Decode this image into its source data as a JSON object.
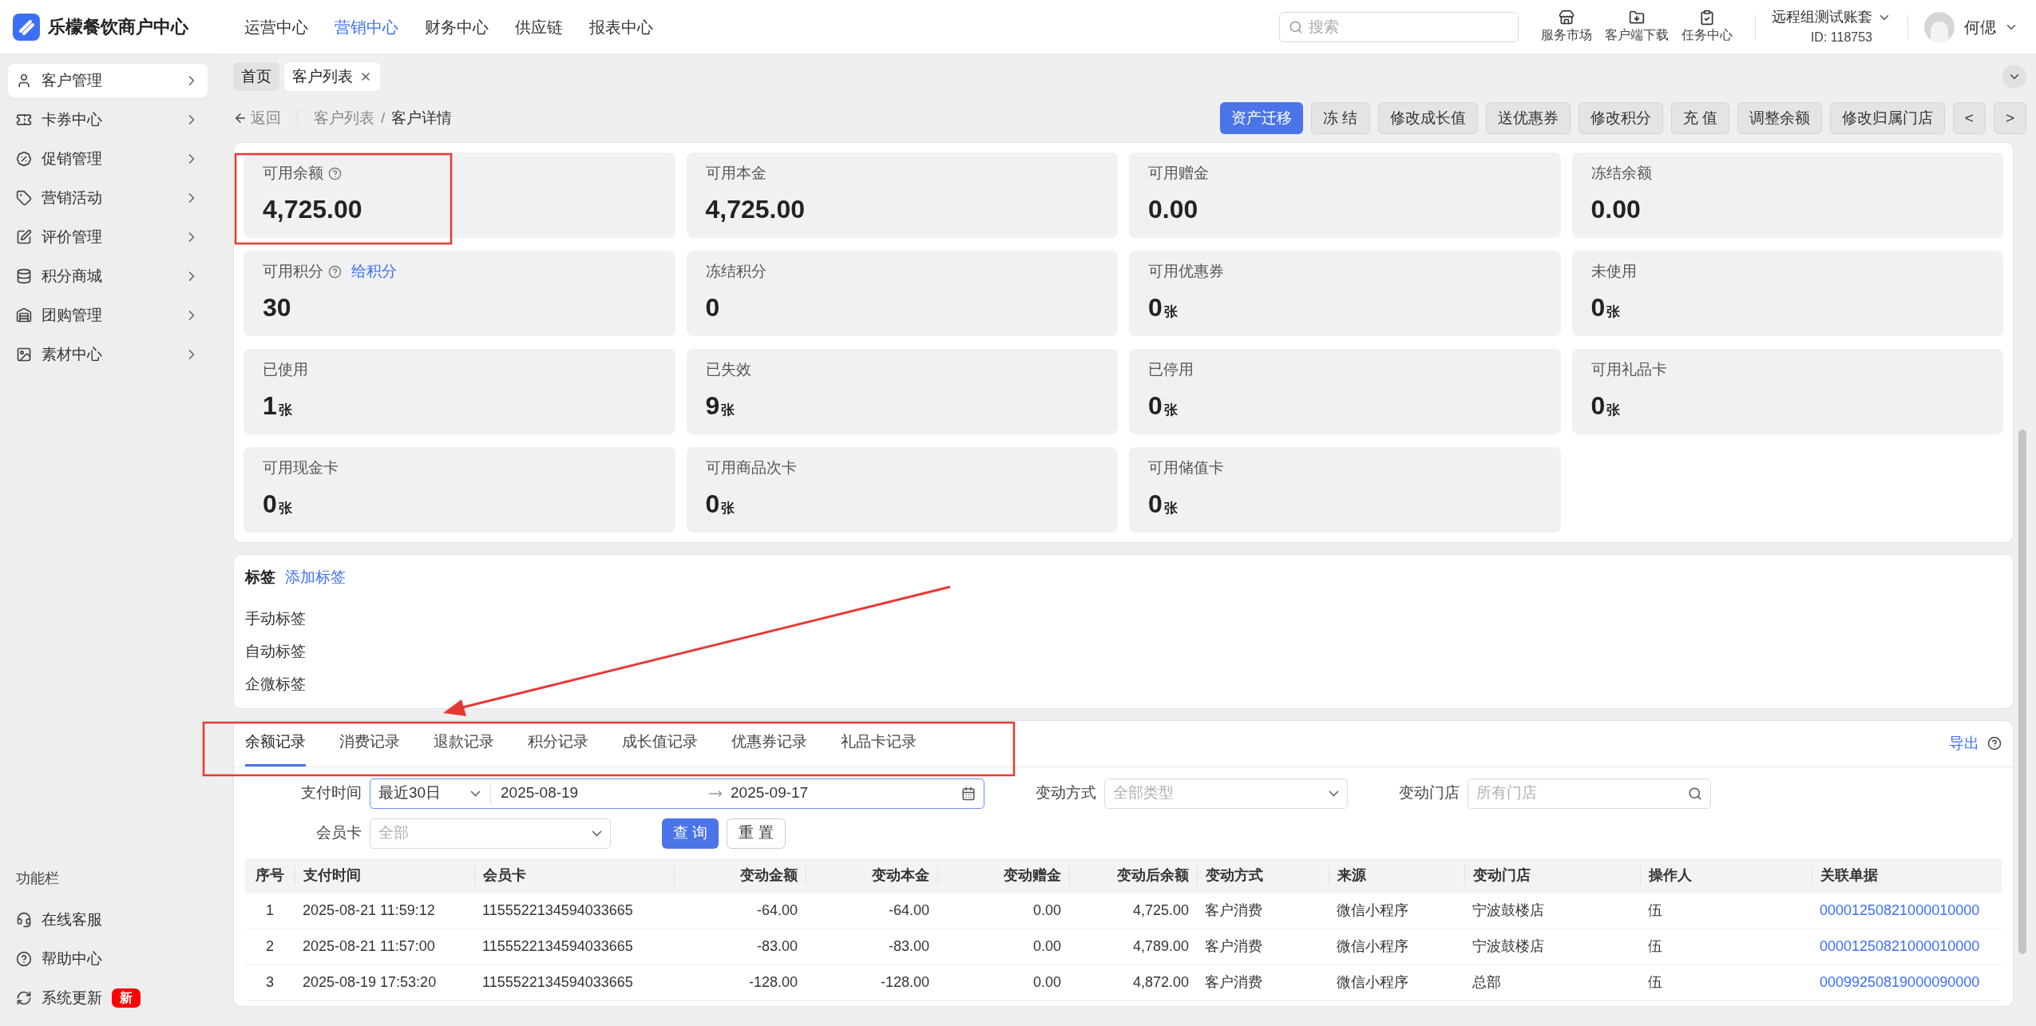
{
  "app": {
    "name": "乐檬餐饮商户中心"
  },
  "top_nav": [
    {
      "label": "运营中心",
      "selected": false
    },
    {
      "label": "营销中心",
      "selected": true
    },
    {
      "label": "财务中心",
      "selected": false
    },
    {
      "label": "供应链",
      "selected": false
    },
    {
      "label": "报表中心",
      "selected": false
    }
  ],
  "search": {
    "placeholder": "搜索"
  },
  "header_tools": [
    {
      "label": "服务市场",
      "kind": "market"
    },
    {
      "label": "客户端下载",
      "kind": "download"
    },
    {
      "label": "任务中心",
      "kind": "tasks"
    }
  ],
  "account": {
    "name": "远程组测试账套",
    "id": "ID: 118753"
  },
  "user": {
    "name": "何偲"
  },
  "sidebar": {
    "items": [
      {
        "label": "客户管理",
        "kind": "user",
        "selected": true
      },
      {
        "label": "卡券中心",
        "kind": "ticket",
        "selected": false
      },
      {
        "label": "促销管理",
        "kind": "promo",
        "selected": false
      },
      {
        "label": "营销活动",
        "kind": "tag",
        "selected": false
      },
      {
        "label": "评价管理",
        "kind": "review",
        "selected": false
      },
      {
        "label": "积分商城",
        "kind": "points",
        "selected": false
      },
      {
        "label": "团购管理",
        "kind": "store",
        "selected": false
      },
      {
        "label": "素材中心",
        "kind": "image",
        "selected": false
      }
    ],
    "section_title": "功能栏",
    "footer_items": [
      {
        "label": "在线客服",
        "kind": "support"
      },
      {
        "label": "帮助中心",
        "kind": "help"
      },
      {
        "label": "系统更新",
        "kind": "update",
        "badge": "新"
      }
    ]
  },
  "page_tabs": [
    {
      "label": "首页",
      "selected": false,
      "closable": false
    },
    {
      "label": "客户列表",
      "selected": true,
      "closable": true
    }
  ],
  "breadcrumb": {
    "back": "返回",
    "items": [
      "客户列表",
      "客户详情"
    ],
    "separator": "/"
  },
  "actions": [
    {
      "label": "资产迁移",
      "primary": true
    },
    {
      "label": "冻 结",
      "primary": false
    },
    {
      "label": "修改成长值",
      "primary": false
    },
    {
      "label": "送优惠券",
      "primary": false
    },
    {
      "label": "修改积分",
      "primary": false
    },
    {
      "label": "充 值",
      "primary": false
    },
    {
      "label": "调整余额",
      "primary": false
    },
    {
      "label": "修改归属门店",
      "primary": false
    },
    {
      "label": "<",
      "primary": false
    },
    {
      "label": ">",
      "primary": false
    }
  ],
  "stats": [
    {
      "label": "可用余额",
      "value": "4,725.00",
      "help": true
    },
    {
      "label": "可用本金",
      "value": "4,725.00"
    },
    {
      "label": "可用赠金",
      "value": "0.00"
    },
    {
      "label": "冻结余额",
      "value": "0.00"
    },
    {
      "label": "可用积分",
      "value": "30",
      "help": true,
      "link": "给积分"
    },
    {
      "label": "冻结积分",
      "value": "0"
    },
    {
      "label": "可用优惠券",
      "value": "0",
      "unit": "张"
    },
    {
      "label": "未使用",
      "value": "0",
      "unit": "张"
    },
    {
      "label": "已使用",
      "value": "1",
      "unit": "张"
    },
    {
      "label": "已失效",
      "value": "9",
      "unit": "张"
    },
    {
      "label": "已停用",
      "value": "0",
      "unit": "张"
    },
    {
      "label": "可用礼品卡",
      "value": "0",
      "unit": "张"
    },
    {
      "label": "可用现金卡",
      "value": "0",
      "unit": "张"
    },
    {
      "label": "可用商品次卡",
      "value": "0",
      "unit": "张"
    },
    {
      "label": "可用储值卡",
      "value": "0",
      "unit": "张"
    }
  ],
  "tags": {
    "title": "标签",
    "add_link": "添加标签",
    "groups": [
      "手动标签",
      "自动标签",
      "企微标签"
    ]
  },
  "records": {
    "tabs": [
      {
        "label": "余额记录",
        "selected": true
      },
      {
        "label": "消费记录",
        "selected": false
      },
      {
        "label": "退款记录",
        "selected": false
      },
      {
        "label": "积分记录",
        "selected": false
      },
      {
        "label": "成长值记录",
        "selected": false
      },
      {
        "label": "优惠券记录",
        "selected": false
      },
      {
        "label": "礼品卡记录",
        "selected": false
      }
    ],
    "export": "导出",
    "filters": [
      {
        "label": "支付时间",
        "kind": "daterange",
        "preset": "最近30日",
        "start": "2025-08-19",
        "end": "2025-09-17",
        "focused": true
      },
      {
        "label": "变动方式",
        "kind": "select",
        "placeholder": "全部类型"
      },
      {
        "label": "变动门店",
        "kind": "search",
        "placeholder": "所有门店"
      },
      {
        "label": "会员卡",
        "kind": "select",
        "placeholder": "全部"
      }
    ],
    "buttons": [
      {
        "label": "查 询",
        "primary": true
      },
      {
        "label": "重 置",
        "primary": false
      }
    ],
    "table": {
      "columns": [
        "序号",
        "支付时间",
        "会员卡",
        "变动金额",
        "变动本金",
        "变动赠金",
        "变动后余额",
        "变动方式",
        "来源",
        "变动门店",
        "操作人",
        "关联单据"
      ],
      "rows": [
        [
          "1",
          "2025-08-21 11:59:12",
          "1155522134594033665",
          "-64.00",
          "-64.00",
          "0.00",
          "4,725.00",
          "客户消费",
          "微信小程序",
          "宁波鼓楼店",
          "伍",
          "00001250821000010000"
        ],
        [
          "2",
          "2025-08-21 11:57:00",
          "1155522134594033665",
          "-83.00",
          "-83.00",
          "0.00",
          "4,789.00",
          "客户消费",
          "微信小程序",
          "宁波鼓楼店",
          "伍",
          "00001250821000010000"
        ],
        [
          "3",
          "2025-08-19 17:53:20",
          "1155522134594033665",
          "-128.00",
          "-128.00",
          "0.00",
          "4,872.00",
          "客户消费",
          "微信小程序",
          "总部",
          "伍",
          "00099250819000090000"
        ]
      ]
    }
  },
  "annotations": [
    {
      "kind": "box"
    },
    {
      "kind": "box"
    },
    {
      "kind": "arrow"
    }
  ]
}
